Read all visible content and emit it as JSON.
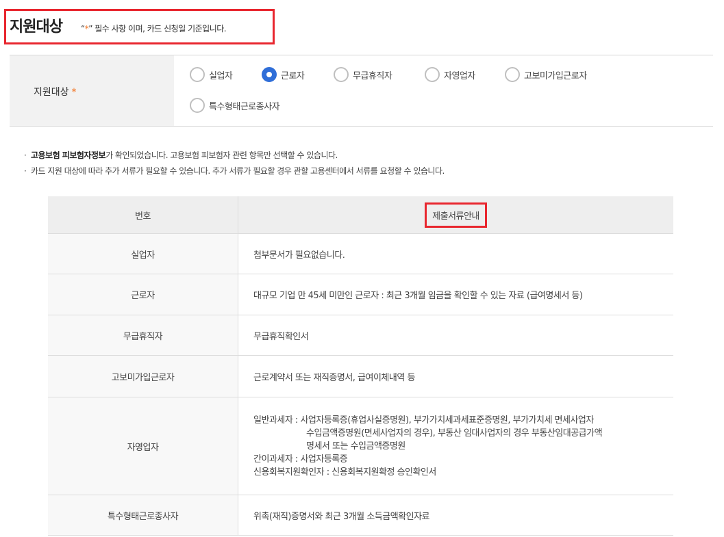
{
  "header": {
    "title": "지원대상",
    "note_open": "“",
    "note_star": "*",
    "note_rest": "” 필수 사항 이며, 카드 신청일 기준입니다."
  },
  "selection": {
    "label": "지원대상",
    "required_star": "*",
    "options": [
      {
        "label": "실업자",
        "checked": false
      },
      {
        "label": "근로자",
        "checked": true
      },
      {
        "label": "무급휴직자",
        "checked": false
      },
      {
        "label": "자영업자",
        "checked": false
      },
      {
        "label": "고보미가입근로자",
        "checked": false
      },
      {
        "label": "특수형태근로종사자",
        "checked": false
      }
    ]
  },
  "notes": {
    "line1_bold": "고용보험 피보험자정보",
    "line1_rest": "가 확인되었습니다. 고용보험 피보험자 관련 항목만 선택할 수 있습니다.",
    "line2": "카드 지원 대상에 따라 추가 서류가 필요할 수 있습니다. 추가 서류가 필요할 경우 관할 고용센터에서 서류를 요청할 수 있습니다.",
    "bullet": "·"
  },
  "table": {
    "headers": [
      "번호",
      "제출서류안내"
    ],
    "rows": [
      {
        "type": "실업자",
        "doc": "첨부문서가 필요없습니다."
      },
      {
        "type": "근로자",
        "doc": "대규모 기업 만 45세 미만인 근로자 : 최근 3개월 임금을 확인할 수 있는 자료 (급여명세서 등)"
      },
      {
        "type": "무급휴직자",
        "doc": "무급휴직확인서"
      },
      {
        "type": "고보미가입근로자",
        "doc": "근로계약서 또는 재직증명서, 급여이체내역 등"
      },
      {
        "type": "자영업자",
        "doc_lines": [
          "일반과세자 : 사업자등록증(휴업사실증명원), 부가가치세과세표준증명원, 부가가치세 면세사업자",
          "수입금액증명원(면세사업자의 경우), 부동산 임대사업자의 경우 부동산임대공급가액",
          "명세서 또는 수입금액증명원",
          "간이과세자 : 사업자등록증",
          "신용회복지원확인자 : 신용회복지원확정 승인확인서"
        ]
      },
      {
        "type": "특수형태근로종사자",
        "doc": "위촉(재직)증명서와 최근 3개월 소득금액확인자료"
      }
    ]
  },
  "colors": {
    "accent": "#f37321",
    "radio_checked": "#2f6ed8",
    "highlight_border": "#e8262e"
  }
}
